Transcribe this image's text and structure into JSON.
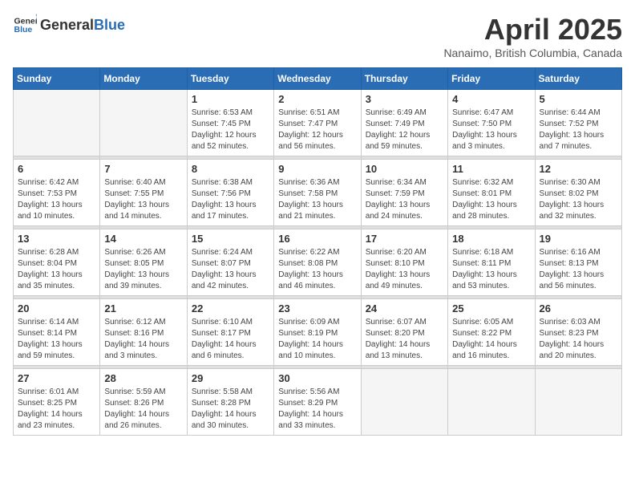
{
  "header": {
    "logo_general": "General",
    "logo_blue": "Blue",
    "title": "April 2025",
    "subtitle": "Nanaimo, British Columbia, Canada"
  },
  "weekdays": [
    "Sunday",
    "Monday",
    "Tuesday",
    "Wednesday",
    "Thursday",
    "Friday",
    "Saturday"
  ],
  "weeks": [
    [
      {
        "day": "",
        "info": ""
      },
      {
        "day": "",
        "info": ""
      },
      {
        "day": "1",
        "info": "Sunrise: 6:53 AM\nSunset: 7:45 PM\nDaylight: 12 hours and 52 minutes."
      },
      {
        "day": "2",
        "info": "Sunrise: 6:51 AM\nSunset: 7:47 PM\nDaylight: 12 hours and 56 minutes."
      },
      {
        "day": "3",
        "info": "Sunrise: 6:49 AM\nSunset: 7:49 PM\nDaylight: 12 hours and 59 minutes."
      },
      {
        "day": "4",
        "info": "Sunrise: 6:47 AM\nSunset: 7:50 PM\nDaylight: 13 hours and 3 minutes."
      },
      {
        "day": "5",
        "info": "Sunrise: 6:44 AM\nSunset: 7:52 PM\nDaylight: 13 hours and 7 minutes."
      }
    ],
    [
      {
        "day": "6",
        "info": "Sunrise: 6:42 AM\nSunset: 7:53 PM\nDaylight: 13 hours and 10 minutes."
      },
      {
        "day": "7",
        "info": "Sunrise: 6:40 AM\nSunset: 7:55 PM\nDaylight: 13 hours and 14 minutes."
      },
      {
        "day": "8",
        "info": "Sunrise: 6:38 AM\nSunset: 7:56 PM\nDaylight: 13 hours and 17 minutes."
      },
      {
        "day": "9",
        "info": "Sunrise: 6:36 AM\nSunset: 7:58 PM\nDaylight: 13 hours and 21 minutes."
      },
      {
        "day": "10",
        "info": "Sunrise: 6:34 AM\nSunset: 7:59 PM\nDaylight: 13 hours and 24 minutes."
      },
      {
        "day": "11",
        "info": "Sunrise: 6:32 AM\nSunset: 8:01 PM\nDaylight: 13 hours and 28 minutes."
      },
      {
        "day": "12",
        "info": "Sunrise: 6:30 AM\nSunset: 8:02 PM\nDaylight: 13 hours and 32 minutes."
      }
    ],
    [
      {
        "day": "13",
        "info": "Sunrise: 6:28 AM\nSunset: 8:04 PM\nDaylight: 13 hours and 35 minutes."
      },
      {
        "day": "14",
        "info": "Sunrise: 6:26 AM\nSunset: 8:05 PM\nDaylight: 13 hours and 39 minutes."
      },
      {
        "day": "15",
        "info": "Sunrise: 6:24 AM\nSunset: 8:07 PM\nDaylight: 13 hours and 42 minutes."
      },
      {
        "day": "16",
        "info": "Sunrise: 6:22 AM\nSunset: 8:08 PM\nDaylight: 13 hours and 46 minutes."
      },
      {
        "day": "17",
        "info": "Sunrise: 6:20 AM\nSunset: 8:10 PM\nDaylight: 13 hours and 49 minutes."
      },
      {
        "day": "18",
        "info": "Sunrise: 6:18 AM\nSunset: 8:11 PM\nDaylight: 13 hours and 53 minutes."
      },
      {
        "day": "19",
        "info": "Sunrise: 6:16 AM\nSunset: 8:13 PM\nDaylight: 13 hours and 56 minutes."
      }
    ],
    [
      {
        "day": "20",
        "info": "Sunrise: 6:14 AM\nSunset: 8:14 PM\nDaylight: 13 hours and 59 minutes."
      },
      {
        "day": "21",
        "info": "Sunrise: 6:12 AM\nSunset: 8:16 PM\nDaylight: 14 hours and 3 minutes."
      },
      {
        "day": "22",
        "info": "Sunrise: 6:10 AM\nSunset: 8:17 PM\nDaylight: 14 hours and 6 minutes."
      },
      {
        "day": "23",
        "info": "Sunrise: 6:09 AM\nSunset: 8:19 PM\nDaylight: 14 hours and 10 minutes."
      },
      {
        "day": "24",
        "info": "Sunrise: 6:07 AM\nSunset: 8:20 PM\nDaylight: 14 hours and 13 minutes."
      },
      {
        "day": "25",
        "info": "Sunrise: 6:05 AM\nSunset: 8:22 PM\nDaylight: 14 hours and 16 minutes."
      },
      {
        "day": "26",
        "info": "Sunrise: 6:03 AM\nSunset: 8:23 PM\nDaylight: 14 hours and 20 minutes."
      }
    ],
    [
      {
        "day": "27",
        "info": "Sunrise: 6:01 AM\nSunset: 8:25 PM\nDaylight: 14 hours and 23 minutes."
      },
      {
        "day": "28",
        "info": "Sunrise: 5:59 AM\nSunset: 8:26 PM\nDaylight: 14 hours and 26 minutes."
      },
      {
        "day": "29",
        "info": "Sunrise: 5:58 AM\nSunset: 8:28 PM\nDaylight: 14 hours and 30 minutes."
      },
      {
        "day": "30",
        "info": "Sunrise: 5:56 AM\nSunset: 8:29 PM\nDaylight: 14 hours and 33 minutes."
      },
      {
        "day": "",
        "info": ""
      },
      {
        "day": "",
        "info": ""
      },
      {
        "day": "",
        "info": ""
      }
    ]
  ]
}
